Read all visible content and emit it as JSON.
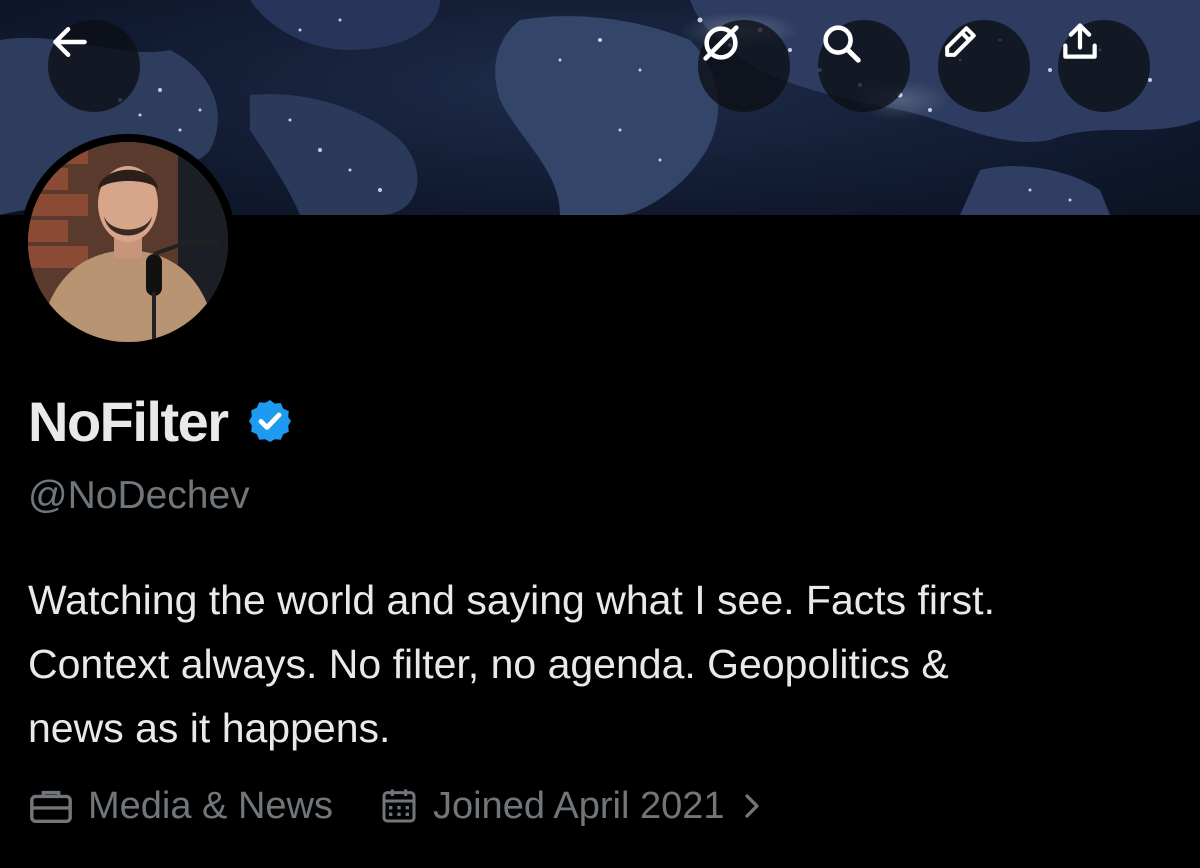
{
  "header": {
    "buttons": [
      {
        "name": "back",
        "icon": "back-arrow-icon"
      },
      {
        "name": "grok",
        "icon": "grok-icon"
      },
      {
        "name": "search",
        "icon": "search-icon"
      },
      {
        "name": "edit",
        "icon": "pencil-icon"
      },
      {
        "name": "share",
        "icon": "share-icon"
      }
    ]
  },
  "profile": {
    "display_name": "NoFilter",
    "verified": true,
    "verified_color": "#1d9bf0",
    "handle": "@NoDechev",
    "bio_lines": [
      "Watching the world and saying what I see. Facts first.",
      "Context always. No filter, no agenda. Geopolitics &",
      "news as it happens."
    ],
    "category": "Media & News",
    "joined": "Joined April 2021"
  },
  "colors": {
    "background": "#000000",
    "text_primary": "#e7e9ea",
    "text_secondary": "#71767b"
  }
}
